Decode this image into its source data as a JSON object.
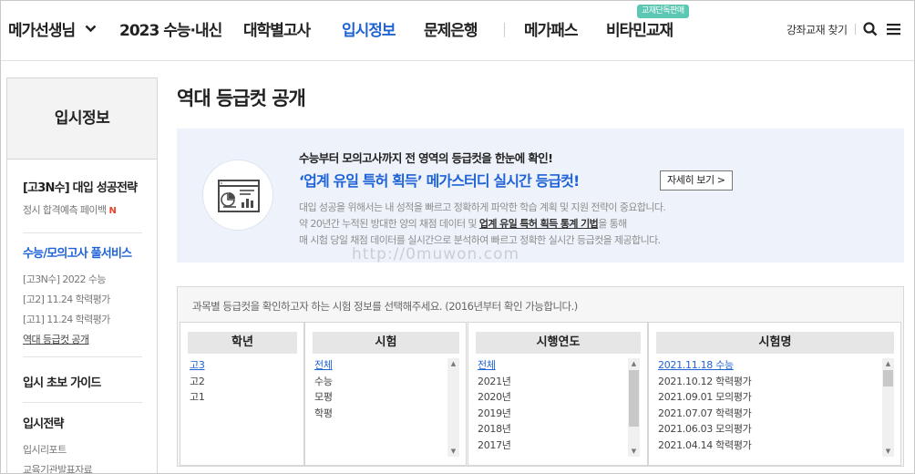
{
  "nav": {
    "brand": "메가선생님",
    "items": [
      "2023 수능·내신",
      "대학별고사",
      "입시정보",
      "문제은행",
      "메가패스",
      "비타민교재"
    ],
    "badge": "교재단독판매",
    "right_link": "강좌교재 찾기",
    "accent": "#1f63d6"
  },
  "sidebar": {
    "header": "입시정보",
    "sec1_title": "[고3N수] 대입 성공전략",
    "sec1_item": "정시 합격예측 페이백",
    "sec1_new": "N",
    "sec2_title": "수능/모의고사 풀서비스",
    "sec2_items": [
      "[고3N수] 2022 수능",
      "[고2] 11.24 학력평가",
      "[고1] 11.24 학력평가",
      "역대 등급컷 공개"
    ],
    "sec3_title": "입시 초보 가이드",
    "sec4_title": "입시전략",
    "sec4_items": [
      "입시리포트",
      "교육기관발표자료"
    ]
  },
  "main": {
    "title": "역대 등급컷 공개",
    "banner": {
      "line1": "수능부터 모의고사까지 전 영역의 등급컷을 한눈에 확인!",
      "line2": "‘업계 유일 특허 획득’ 메가스터디 실시간 등급컷!",
      "detail": "자세히 보기 >",
      "desc1": "대입 성공을 위해서는 내 성적을 빠르고 정확하게 파악한 학습 계획 및 지원 전략이 중요합니다.",
      "desc2_a": "약 20년간 누적된 방대한 양의 채점 데이터 및 ",
      "desc2_b": "업계 유일 특허 획득 통계 기법",
      "desc2_c": "을 통해",
      "desc3": "매 시험 당일 채점 데이터를 실시간으로 분석하여 빠르고 정확한 실시간 등급컷을 제공합니다."
    },
    "selector": {
      "hint": "과목별 등급컷을 확인하고자 하는 시험 정보를 선택해주세요. (2016년부터 확인 가능합니다.)",
      "columns": [
        {
          "header": "학년",
          "items": [
            "고3",
            "고2",
            "고1"
          ]
        },
        {
          "header": "시험",
          "items": [
            "전체",
            "수능",
            "모평",
            "학평"
          ]
        },
        {
          "header": "시행연도",
          "items": [
            "전체",
            "2021년",
            "2020년",
            "2019년",
            "2018년",
            "2017년"
          ]
        },
        {
          "header": "시험명",
          "items": [
            "2021.11.18 수능",
            "2021.10.12 학력평가",
            "2021.09.01 모의평가",
            "2021.07.07 학력평가",
            "2021.06.03 모의평가",
            "2021.04.14 학력평가"
          ]
        }
      ]
    }
  },
  "watermark": "http://0muwon.com"
}
